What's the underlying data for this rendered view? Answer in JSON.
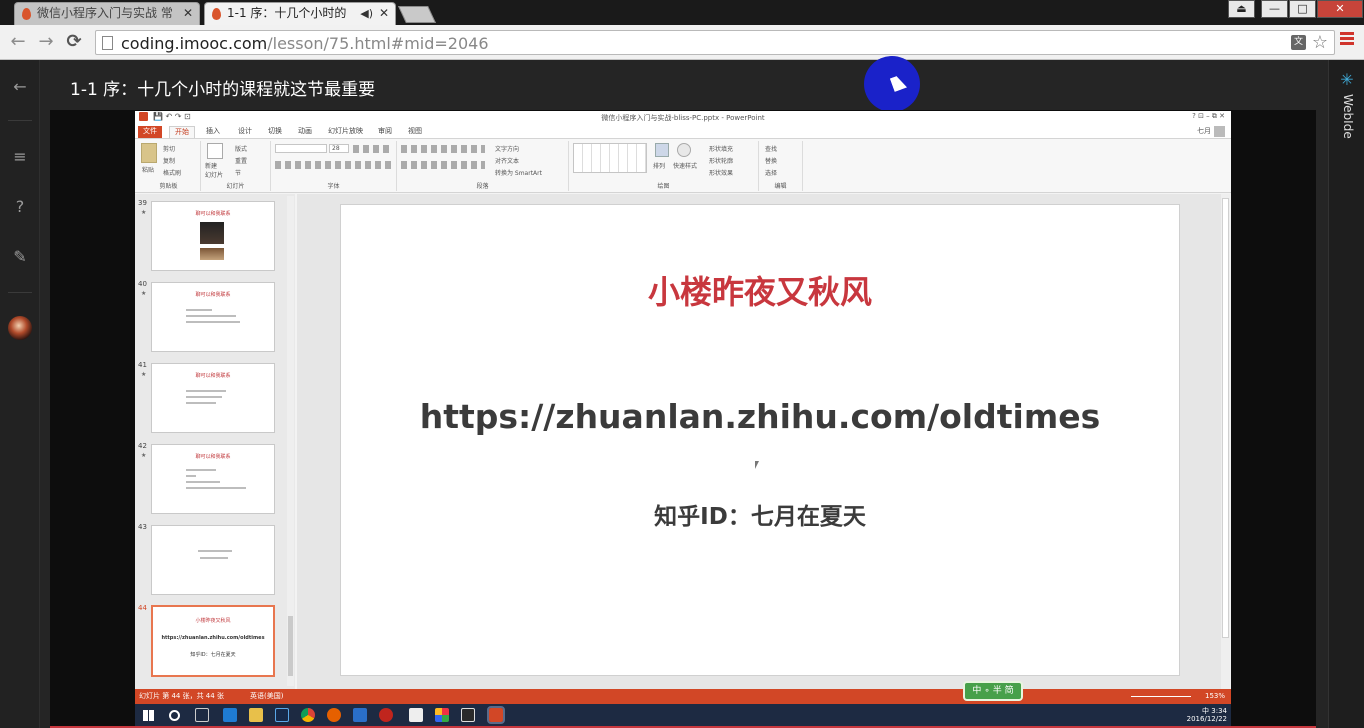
{
  "browser": {
    "tabs": [
      {
        "title": "微信小程序入门与实战 常",
        "active": false
      },
      {
        "title": "1-1 序：十几个小时的",
        "active": true
      }
    ],
    "window_controls": {
      "minimize": "—",
      "maximize": "□",
      "close": "✕"
    },
    "nav": {
      "back": "←",
      "forward": "→",
      "reload": "C"
    },
    "url": {
      "host": "coding.imooc.com",
      "path": "/lesson/75.html#mid=2046"
    },
    "icons": {
      "translate": "translate-icon",
      "bookmark": "star-icon",
      "menu": "hamburger-menu-icon"
    },
    "accent_color": "#d0342c"
  },
  "page": {
    "lesson_title": "1-1 序：十几个小时的课程就这节最重要",
    "left_rail": {
      "icons": [
        "back-arrow-icon",
        "list-icon",
        "question-icon",
        "pencil-icon",
        "avatar"
      ]
    },
    "right_rail": {
      "label": "WebIde",
      "accent": "#3fa9d6"
    }
  },
  "ppt": {
    "window_title": "微信小程序入门与实战-bliss-PC.pptx - PowerPoint",
    "title_controls": "?   ⊡   –   ⧉   ✕",
    "user": "七月",
    "ribbon_tabs": [
      "文件",
      "开始",
      "插入",
      "设计",
      "切换",
      "动画",
      "幻灯片放映",
      "审阅",
      "视图"
    ],
    "active_tab": "开始",
    "ribbon_groups": {
      "clipboard": {
        "label": "剪贴板",
        "paste": "粘贴",
        "cut": "剪切",
        "copy": "复制",
        "format_painter": "格式刷"
      },
      "slides": {
        "label": "幻灯片",
        "new_slide": "新建\n幻灯片",
        "layout": "版式",
        "reset": "重置",
        "section": "节"
      },
      "font": {
        "label": "字体",
        "size": "28"
      },
      "paragraph": {
        "label": "段落",
        "text_direction": "文字方向",
        "align_text": "对齐文本",
        "smartart": "转换为 SmartArt"
      },
      "drawing": {
        "label": "绘图",
        "arrange": "排列",
        "quick_styles": "快速样式",
        "fill": "形状填充",
        "outline": "形状轮廓",
        "effects": "形状效果"
      },
      "editing": {
        "label": "编辑",
        "find": "查找",
        "replace": "替换",
        "select": "选择"
      }
    },
    "thumbnails": [
      {
        "num": "39",
        "star": "★",
        "heading": "聊可以和我联系",
        "kind": "photo"
      },
      {
        "num": "40",
        "star": "★",
        "heading": "聊可以和我联系",
        "lines": 3
      },
      {
        "num": "41",
        "star": "★",
        "heading": "聊可以和我联系",
        "lines": 3
      },
      {
        "num": "42",
        "star": "★",
        "heading": "聊可以和我联系",
        "lines": 4
      },
      {
        "num": "43",
        "star": "",
        "heading": "",
        "lines": 2
      },
      {
        "num": "44",
        "star": "",
        "heading": "小楼昨夜又秋风",
        "url": "https://zhuanlan.zhihu.com/oldtimes",
        "id": "知乎ID：七月在夏天",
        "selected": true
      }
    ],
    "slide": {
      "title": "小楼昨夜又秋风",
      "url": "https://zhuanlan.zhihu.com/oldtimes",
      "zhihu_id": "知乎ID：七月在夏天",
      "title_color": "#c8373e"
    },
    "status": {
      "slide_info": "幻灯片 第 44 张，共 44 张",
      "language": "英语(美国)",
      "zoom": "153%",
      "ime": "中 ∘ 半 简"
    },
    "taskbar": {
      "time": "3:34",
      "date": "2016/12/22",
      "ime_indicator": "中",
      "icons": [
        "windows-start-icon",
        "search-circle-icon",
        "task-view-icon",
        "edge-icon",
        "folder-icon",
        "photoshop-icon",
        "chrome-icon",
        "firefox-icon",
        "vscode-icon",
        "recorder-icon",
        "editor-icon",
        "apps-icon",
        "photos-icon",
        "powerpoint-icon"
      ]
    }
  }
}
